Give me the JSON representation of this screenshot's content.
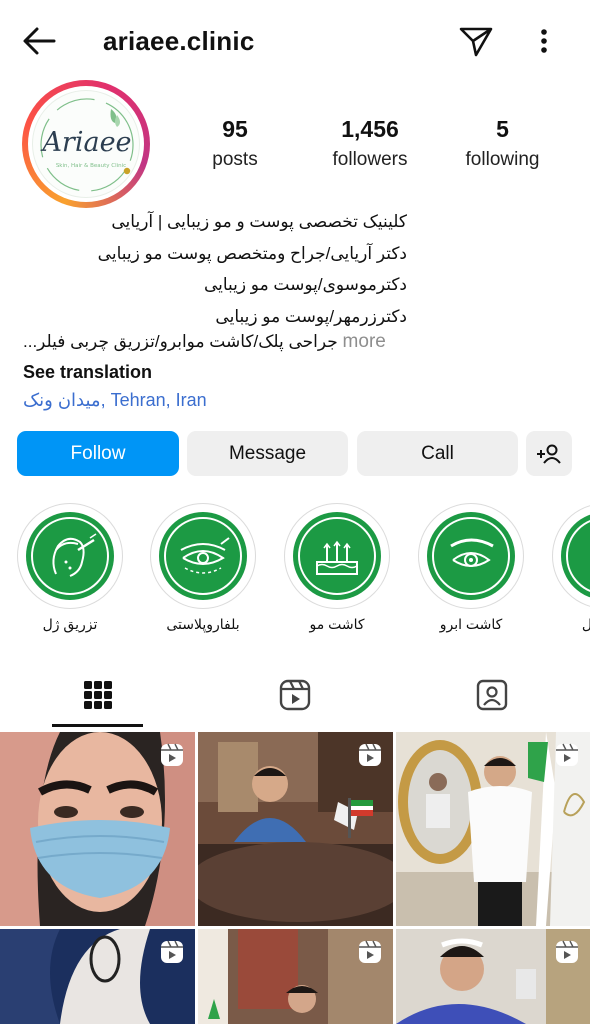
{
  "header": {
    "username": "ariaee.clinic",
    "back_icon": "arrow-left-icon",
    "send_icon": "paper-plane-icon",
    "more_icon": "more-vertical-icon"
  },
  "profile": {
    "avatar_logo_text": "Ariaee",
    "avatar_logo_subtext": "Skin, Hair & Beauty Clinic",
    "stats": {
      "posts": {
        "value": "95",
        "label": "posts"
      },
      "followers": {
        "value": "1,456",
        "label": "followers"
      },
      "following": {
        "value": "5",
        "label": "following"
      }
    },
    "bio": {
      "line1": "کلینیک تخصصی پوست و مو زیبایی | آریایی",
      "line2": "دکتر آریایی/جراح ومتخصص پوست مو زیبایی",
      "line3": "دکترموسوی/پوست مو زیبایی",
      "line4": "دکترزرمهر/پوست مو زیبایی",
      "line5": "جراحی پلک/کاشت موابرو/تزریق چربی فیلر...",
      "more": "more"
    },
    "see_translation": "See translation",
    "location": "میدان ونک, Tehran, Iran"
  },
  "actions": {
    "follow": "Follow",
    "message": "Message",
    "call": "Call",
    "add_user_icon": "add-user-icon"
  },
  "highlights": [
    {
      "label": "تزریق ژل"
    },
    {
      "label": "بلفاروپلاستی"
    },
    {
      "label": "کاشت مو"
    },
    {
      "label": "کاشت ابرو"
    },
    {
      "label": "ل"
    }
  ],
  "tabs": [
    {
      "icon": "grid-icon",
      "active": true
    },
    {
      "icon": "reels-icon",
      "active": false
    },
    {
      "icon": "tagged-icon",
      "active": false
    }
  ],
  "colors": {
    "follow_blue": "#0095f6",
    "highlight_green": "#1c9a44",
    "location_blue": "#3b6ecf"
  }
}
